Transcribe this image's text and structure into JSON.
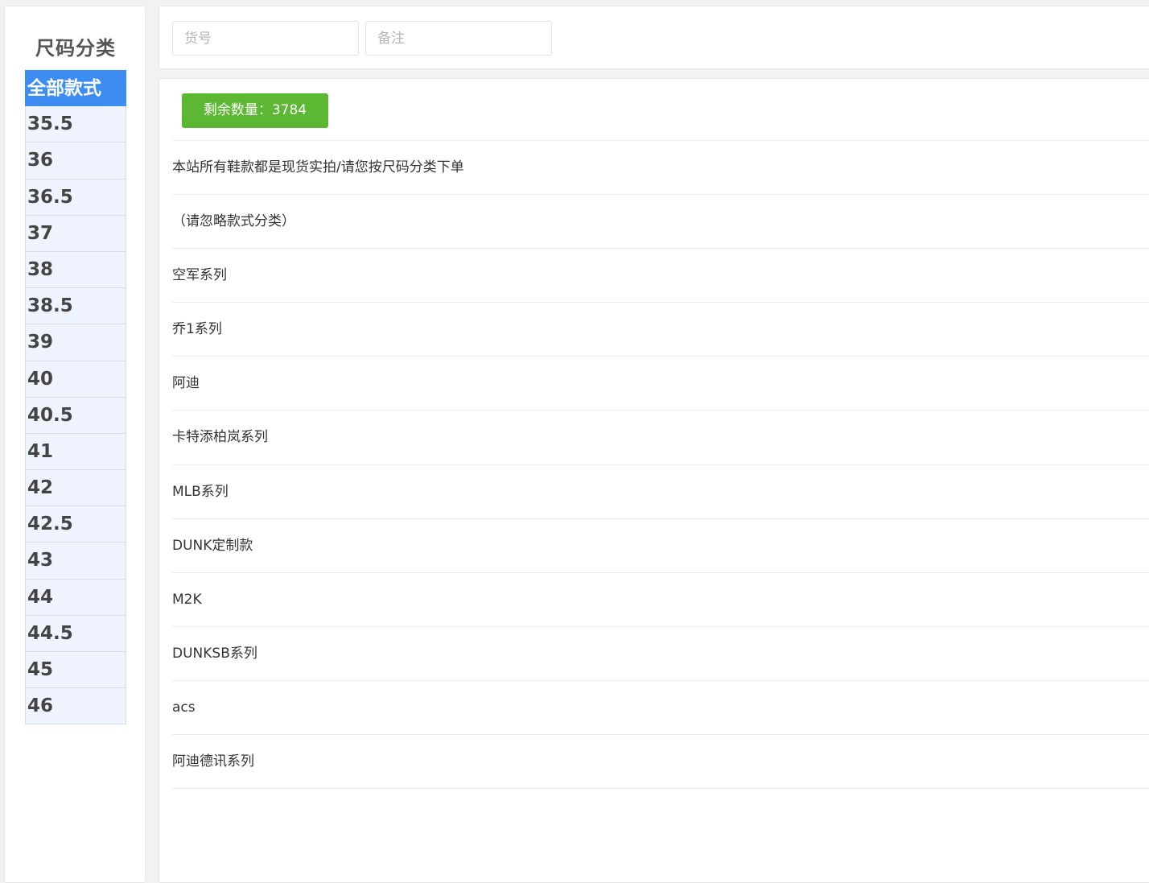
{
  "sidebar": {
    "title": "尺码分类",
    "sizes": [
      {
        "label": "全部款式",
        "active": true
      },
      {
        "label": "35.5"
      },
      {
        "label": "36"
      },
      {
        "label": "36.5"
      },
      {
        "label": "37"
      },
      {
        "label": "38"
      },
      {
        "label": "38.5"
      },
      {
        "label": "39"
      },
      {
        "label": "40"
      },
      {
        "label": "40.5"
      },
      {
        "label": "41"
      },
      {
        "label": "42"
      },
      {
        "label": "42.5"
      },
      {
        "label": "43"
      },
      {
        "label": "44"
      },
      {
        "label": "44.5"
      },
      {
        "label": "45"
      },
      {
        "label": "46"
      }
    ]
  },
  "search": {
    "item_no_placeholder": "货号",
    "remark_placeholder": "备注"
  },
  "content": {
    "remaining_count": "剩余数量：3784",
    "categories": [
      "本站所有鞋款都是现货实拍/请您按尺码分类下单",
      " （请忽略款式分类）",
      "空军系列",
      "乔1系列",
      "阿迪",
      "卡特添柏岚系列",
      "MLB系列",
      "DUNK定制款",
      "M2K",
      "DUNKSB系列",
      "acs",
      "阿迪德讯系列"
    ]
  },
  "colors": {
    "active_blue": "#3d8cf4",
    "badge_green": "#5cb832"
  }
}
